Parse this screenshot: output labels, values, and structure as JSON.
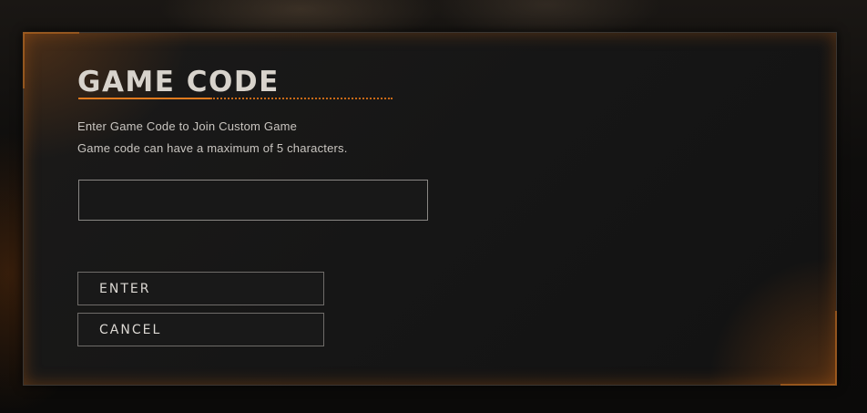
{
  "dialog": {
    "title": "GAME CODE",
    "description_line1": "Enter Game Code to Join Custom Game",
    "description_line2": "Game code can have a maximum of 5 characters.",
    "code_input": {
      "value": "",
      "placeholder": "",
      "max_length": 5
    },
    "enter_label": "ENTER",
    "cancel_label": "CANCEL"
  },
  "colors": {
    "accent": "#e07a1e",
    "panel": "#161616",
    "text": "#d8d3cc"
  }
}
